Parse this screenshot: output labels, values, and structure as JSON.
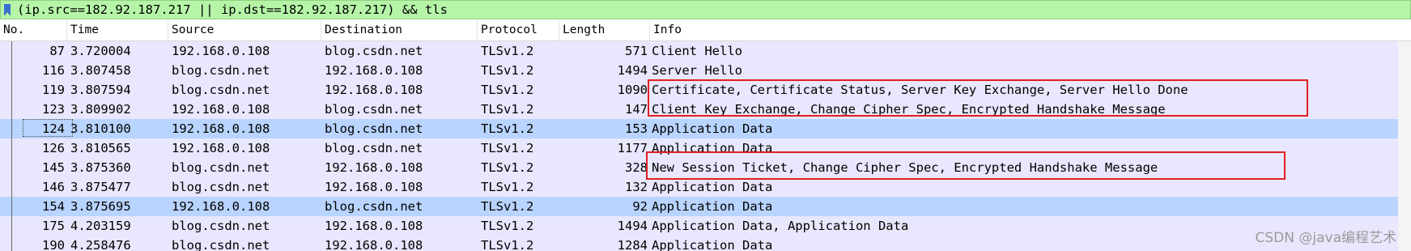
{
  "filter": {
    "expression": "(ip.src==182.92.187.217 || ip.dst==182.92.187.217) && tls"
  },
  "columns": {
    "no": "No.",
    "time": "Time",
    "source": "Source",
    "destination": "Destination",
    "protocol": "Protocol",
    "length": "Length",
    "info": "Info"
  },
  "packets": [
    {
      "no": "87",
      "time": "3.720004",
      "source": "192.168.0.108",
      "destination": "blog.csdn.net",
      "protocol": "TLSv1.2",
      "length": "571",
      "info": "Client Hello",
      "selected": false
    },
    {
      "no": "116",
      "time": "3.807458",
      "source": "blog.csdn.net",
      "destination": "192.168.0.108",
      "protocol": "TLSv1.2",
      "length": "1494",
      "info": "Server Hello",
      "selected": false
    },
    {
      "no": "119",
      "time": "3.807594",
      "source": "blog.csdn.net",
      "destination": "192.168.0.108",
      "protocol": "TLSv1.2",
      "length": "1090",
      "info": "Certificate, Certificate Status, Server Key Exchange, Server Hello Done",
      "selected": false
    },
    {
      "no": "123",
      "time": "3.809902",
      "source": "192.168.0.108",
      "destination": "blog.csdn.net",
      "protocol": "TLSv1.2",
      "length": "147",
      "info": "Client Key Exchange, Change Cipher Spec, Encrypted Handshake Message",
      "selected": false
    },
    {
      "no": "124",
      "time": "3.810100",
      "source": "192.168.0.108",
      "destination": "blog.csdn.net",
      "protocol": "TLSv1.2",
      "length": "153",
      "info": "Application Data",
      "selected": true
    },
    {
      "no": "126",
      "time": "3.810565",
      "source": "192.168.0.108",
      "destination": "blog.csdn.net",
      "protocol": "TLSv1.2",
      "length": "1177",
      "info": "Application Data",
      "selected": false
    },
    {
      "no": "145",
      "time": "3.875360",
      "source": "blog.csdn.net",
      "destination": "192.168.0.108",
      "protocol": "TLSv1.2",
      "length": "328",
      "info": "New Session Ticket, Change Cipher Spec, Encrypted Handshake Message",
      "selected": false
    },
    {
      "no": "146",
      "time": "3.875477",
      "source": "blog.csdn.net",
      "destination": "192.168.0.108",
      "protocol": "TLSv1.2",
      "length": "132",
      "info": "Application Data",
      "selected": false
    },
    {
      "no": "154",
      "time": "3.875695",
      "source": "192.168.0.108",
      "destination": "blog.csdn.net",
      "protocol": "TLSv1.2",
      "length": "92",
      "info": "Application Data",
      "selected": false
    },
    {
      "no": "175",
      "time": "4.203159",
      "source": "blog.csdn.net",
      "destination": "192.168.0.108",
      "protocol": "TLSv1.2",
      "length": "1494",
      "info": "Application Data, Application Data",
      "selected": false
    },
    {
      "no": "190",
      "time": "4.258476",
      "source": "blog.csdn.net",
      "destination": "192.168.0.108",
      "protocol": "TLSv1.2",
      "length": "1284",
      "info": "Application Data",
      "selected": false
    }
  ],
  "watermark": "CSDN @java编程艺术",
  "colors": {
    "filter_bg": "#b6f5a8",
    "row_bg": "#e8e7fd",
    "selected_bg": "#b8d4ff",
    "highlight_border": "#e02020"
  },
  "icons": {
    "filter_bookmark": "bookmark-icon"
  }
}
